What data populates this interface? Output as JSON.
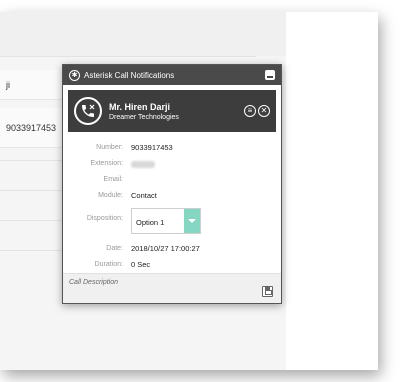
{
  "background": {
    "row1_text": "ji",
    "row2_text": "9033917453"
  },
  "popup": {
    "title": "Asterisk Call Notifications",
    "caller": {
      "name": "Mr. Hiren Darji",
      "company": "Dreamer Technologies"
    },
    "fields": {
      "number_label": "Number:",
      "number_value": "9033917453",
      "extension_label": "Extension:",
      "email_label": "Email:",
      "module_label": "Module:",
      "module_value": "Contact",
      "disposition_label": "Disposition:",
      "disposition_value": "Option 1",
      "date_label": "Date:",
      "date_value": "2018/10/27 17:00:27",
      "duration_label": "Duration:",
      "duration_value": "0 Sec"
    },
    "description_label": "Call Description"
  },
  "icons": {
    "title": "asterisk-icon",
    "minimize": "minimize-icon",
    "phone": "phone-icon",
    "list": "list-icon",
    "close": "close-icon",
    "dropdown": "chevron-down-icon",
    "save": "save-icon"
  },
  "colors": {
    "titlebar": "#4a4a4a",
    "header": "#3d3d3d",
    "dropdown_accent": "#86d6c4"
  }
}
